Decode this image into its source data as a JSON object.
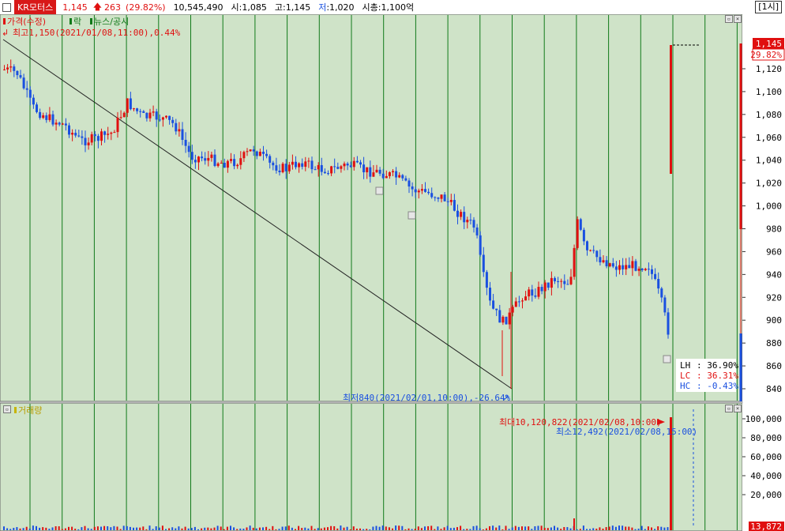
{
  "header": {
    "ticker": "KR모터스",
    "price": "1,145",
    "change": "263",
    "change_pct": "(29.82%)",
    "volume": "10,545,490",
    "open": "시:1,085",
    "high": "고:1,145",
    "low_label": "저",
    "low_value": ":1,020",
    "market_cap": "시총:1,100억",
    "timeframe": "[1시]"
  },
  "price_panel": {
    "legend_price": "가격(수정)",
    "legend_rak": "락",
    "legend_news": "뉴스/공시",
    "max_label": "최고1,150(2021/01/08,11:00),0.44%",
    "min_label": "최저840(2021/02/01,10:00),-26.64%",
    "current_price_tag": "1,145",
    "current_pct_tag": "29.82%",
    "stats": [
      {
        "key": "LH",
        "value": ": 36.90%",
        "color": "#000000"
      },
      {
        "key": "LC",
        "value": ": 36.31%",
        "color": "#e01010"
      },
      {
        "key": "HC",
        "value": ": -0.43%",
        "color": "#1a50e0"
      }
    ],
    "y_ticks": [
      "1,120",
      "1,100",
      "1,080",
      "1,060",
      "1,040",
      "1,020",
      "1,000",
      "980",
      "960",
      "940",
      "920",
      "900",
      "880",
      "860",
      "840"
    ]
  },
  "volume_panel": {
    "legend": "거래량",
    "max_label": "최대10,120,822(2021/02/08,10:00)",
    "min_label": "최소12,492(2021/02/08,15:00)",
    "current_tag": "13,872",
    "y_ticks": [
      "100,000",
      "80,000",
      "60,000",
      "40,000",
      "20,000"
    ]
  },
  "colors": {
    "background": "#cfe3c8",
    "gridline": "#117a1a",
    "up": "#e01010",
    "down": "#1a50e0"
  }
}
